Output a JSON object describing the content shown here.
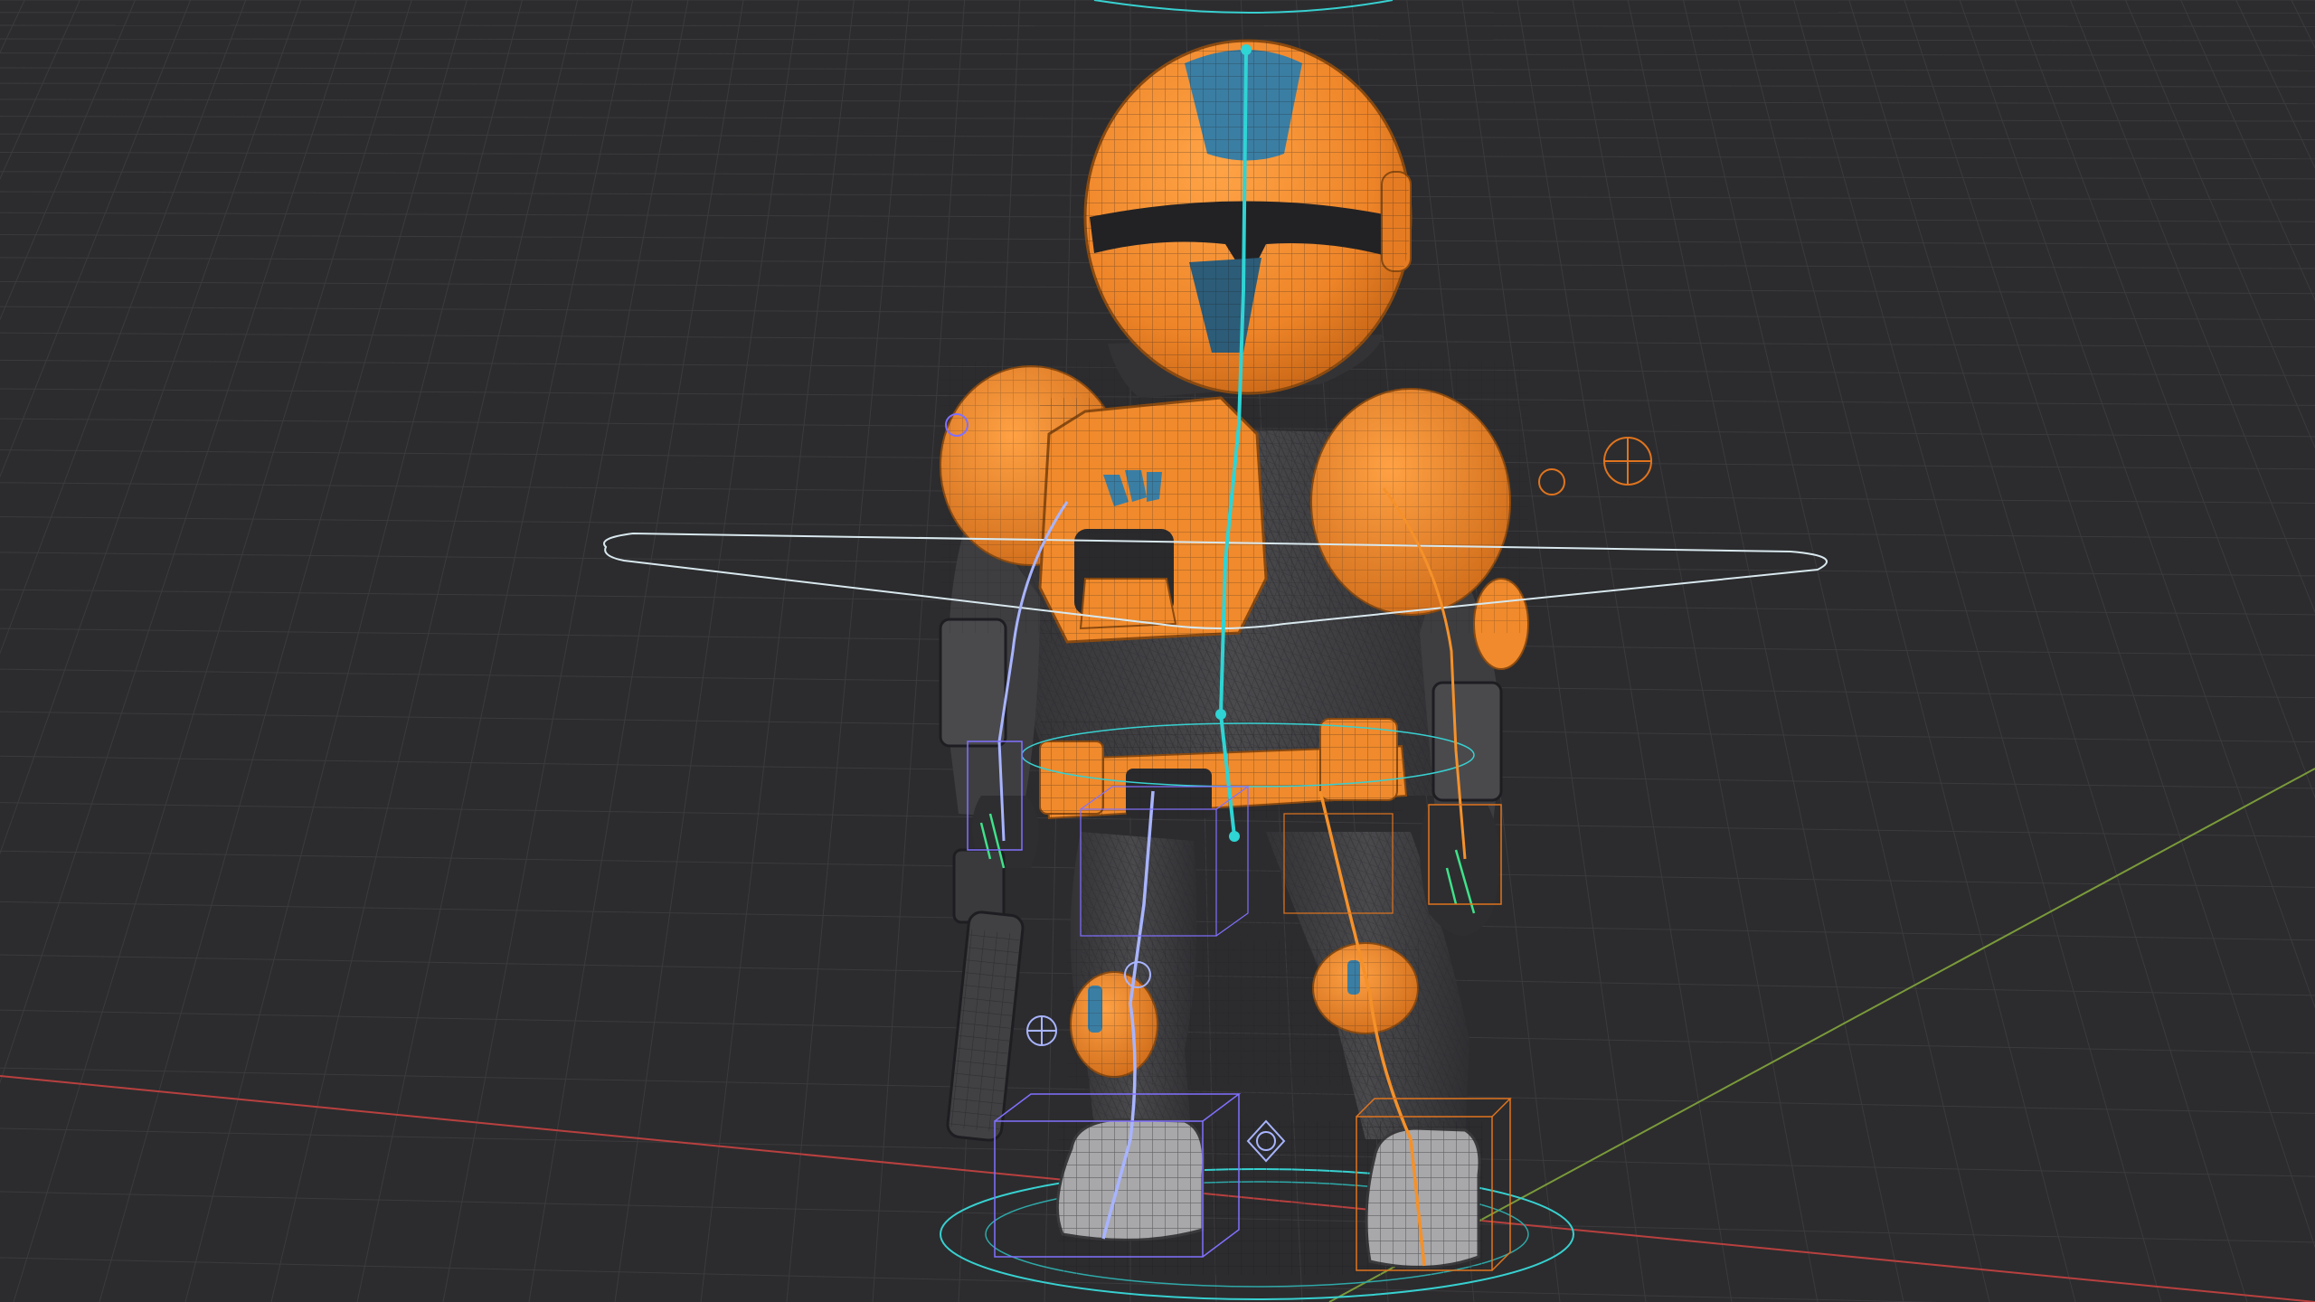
{
  "viewport": {
    "background": "#2c2c2e",
    "grid_color": "#3b3b3e",
    "grid_major_color": "#444448",
    "x_axis_color": "#b8403f",
    "y_axis_color": "#7a9a3a"
  },
  "character": {
    "armor_color": "#f08a2c",
    "armor_shadow": "#c8671a",
    "suit_color": "#3a3a3c",
    "visor_accent": "#3b7ea3",
    "wire_color": "#1f1f22"
  },
  "rig": {
    "root_control_color": "#38d0d0",
    "left_bone_color": "#a8b4ff",
    "right_bone_color": "#f5912a",
    "spine_color": "#2fd4d4",
    "ik_box_left_color": "#8070ff",
    "ik_box_right_color": "#e0741e"
  },
  "icons": [
    "target-control-icon",
    "pole-target-icon"
  ]
}
